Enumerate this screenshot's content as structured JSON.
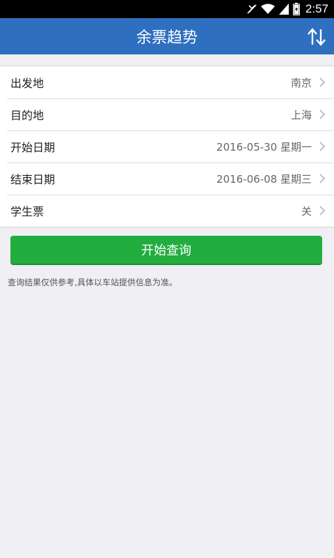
{
  "status_bar": {
    "time": "2:57",
    "icons": [
      "mute-icon",
      "wifi-icon",
      "signal-icon",
      "battery-icon"
    ]
  },
  "app_bar": {
    "title": "余票趋势",
    "swap_icon": "swap-arrows-icon"
  },
  "form": {
    "rows": [
      {
        "label": "出发地",
        "value": "南京"
      },
      {
        "label": "目的地",
        "value": "上海"
      },
      {
        "label": "开始日期",
        "value": "2016-05-30 星期一"
      },
      {
        "label": "结束日期",
        "value": "2016-06-08 星期三"
      },
      {
        "label": "学生票",
        "value": "关"
      }
    ]
  },
  "query_button": {
    "label": "开始查询"
  },
  "disclaimer": "查询结果仅供参考,具体以车站提供信息为准。",
  "colors": {
    "app_bar": "#2f6fc0",
    "button": "#22ad3f",
    "background": "#efeff4"
  }
}
